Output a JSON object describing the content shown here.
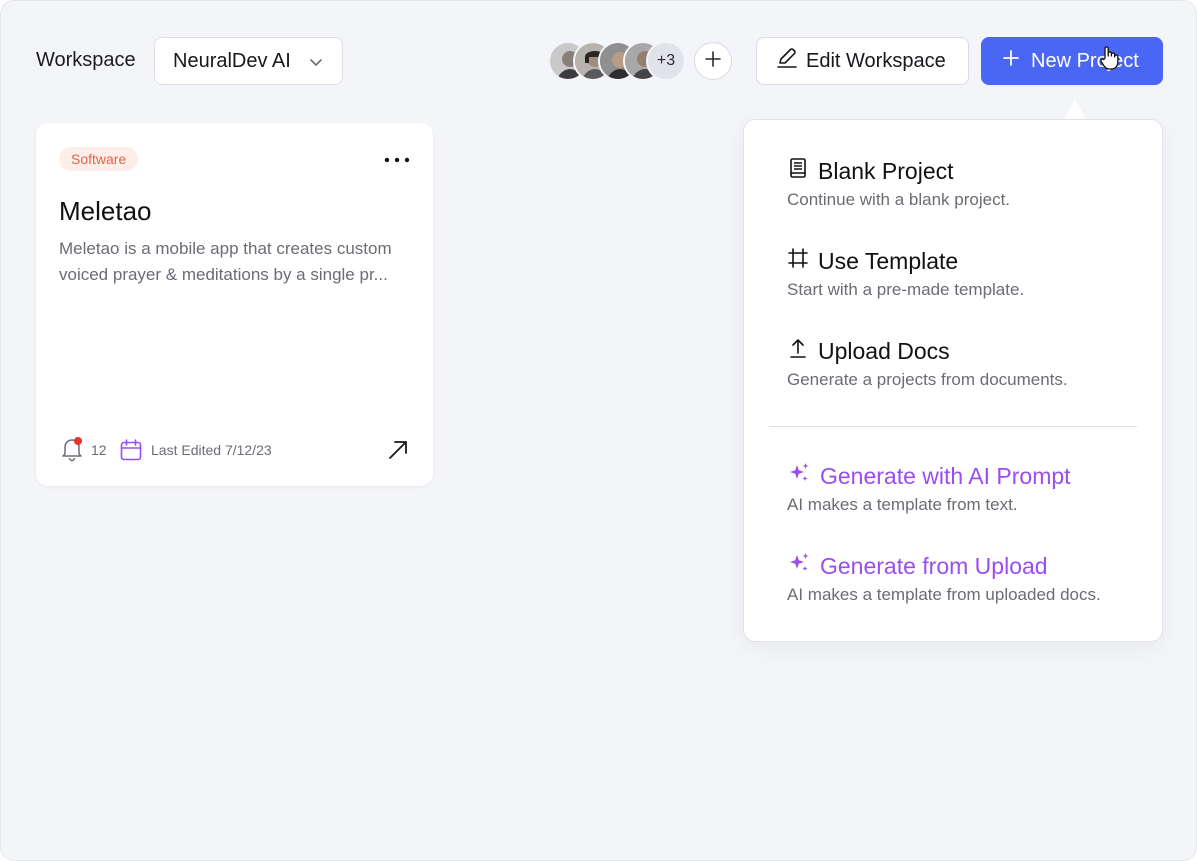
{
  "header": {
    "workspace_label": "Workspace",
    "workspace_selected": "NeuralDev AI",
    "members_more": "+3",
    "edit_workspace_label": "Edit Workspace",
    "new_project_label": "New Project"
  },
  "project_card": {
    "tag": "Software",
    "title": "Meletao",
    "description": "Meletao is a mobile app that creates custom voiced prayer & meditations by a single pr...",
    "notification_count": "12",
    "last_edited": "Last Edited 7/12/23"
  },
  "new_project_menu": {
    "items": [
      {
        "title": "Blank Project",
        "description": "Continue with a blank project.",
        "icon": "book-icon"
      },
      {
        "title": "Use Template",
        "description": "Start with a pre-made template.",
        "icon": "frame-icon"
      },
      {
        "title": "Upload Docs",
        "description": "Generate a projects from documents.",
        "icon": "upload-icon"
      },
      {
        "title": "Generate with AI Prompt",
        "description": "AI makes a template from text.",
        "icon": "sparkles-icon"
      },
      {
        "title": "Generate from Upload",
        "description": "AI makes a template from uploaded docs.",
        "icon": "sparkles-icon"
      }
    ]
  },
  "colors": {
    "primary": "#4a66f5",
    "ai_accent": "#9b4df0",
    "tag_text": "#e2664a",
    "tag_bg": "#fdeeea",
    "notification_dot": "#e5352b",
    "calendar_accent": "#9b4df0"
  }
}
